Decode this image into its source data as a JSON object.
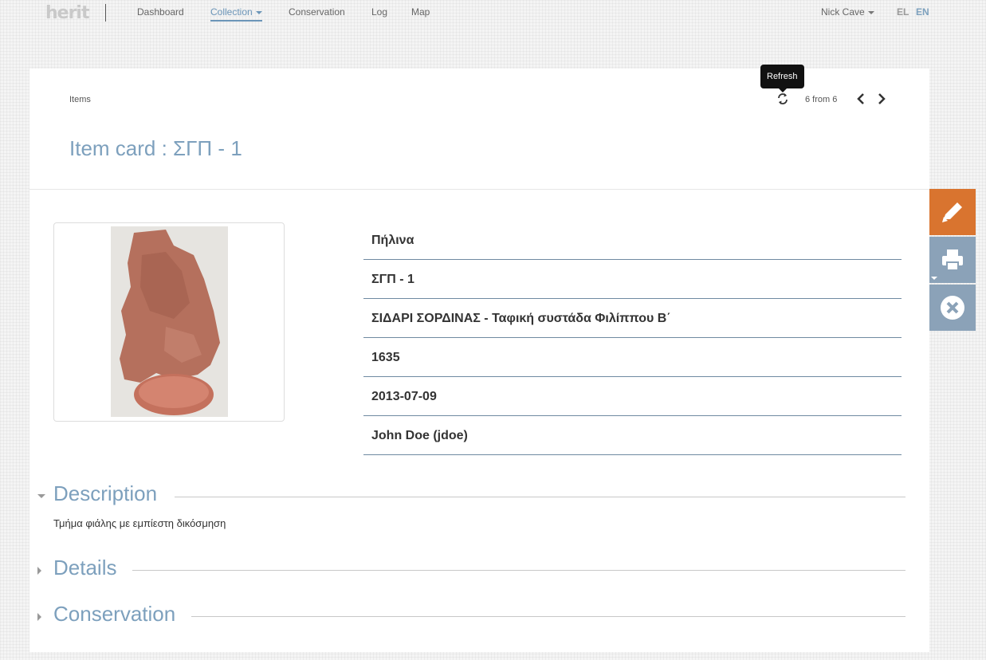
{
  "nav": {
    "logo": "herit",
    "links": [
      "Dashboard",
      "Collection",
      "Conservation",
      "Log",
      "Map"
    ],
    "user": "Nick Cave",
    "lang_el": "EL",
    "lang_en": "EN"
  },
  "header": {
    "breadcrumb": "Items",
    "title": "Item card : ΣΓΠ - 1",
    "refresh_tooltip": "Refresh",
    "pager": "6 from 6"
  },
  "info_rows": [
    "Πήλινα",
    "ΣΓΠ - 1",
    "ΣΙΔΑΡΙ ΣΟΡΔΙΝΑΣ - Ταφική συστάδα Φιλίππου Β΄",
    "1635",
    "2013-07-09",
    "John Doe (jdoe)"
  ],
  "sections": {
    "description_title": "Description",
    "description_text": "Τμήμα φιάλης με εμπίεστη δικόσμηση",
    "details_title": "Details",
    "conservation_title": "Conservation"
  },
  "colors": {
    "accent": "#7da0bd",
    "edit_button": "#d9742f",
    "side_button": "#8ba2b8"
  },
  "icons": [
    "refresh-icon",
    "chevron-left-icon",
    "chevron-right-icon",
    "pencil-icon",
    "print-icon",
    "close-circle-icon"
  ]
}
